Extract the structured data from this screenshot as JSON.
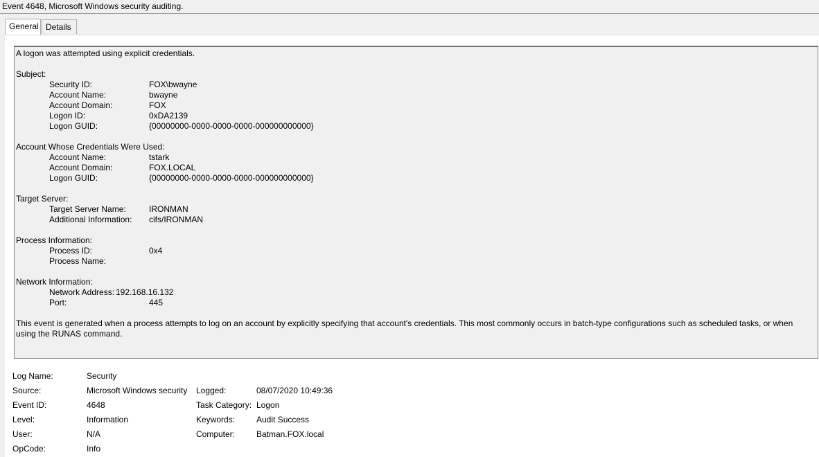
{
  "window": {
    "title": "Event 4648, Microsoft Windows security auditing."
  },
  "tabs": [
    {
      "label": "General"
    },
    {
      "label": "Details"
    }
  ],
  "description": {
    "intro": "A logon was attempted using explicit credentials.",
    "subject": {
      "heading": "Subject:",
      "fields": [
        {
          "label": "Security ID:",
          "value": "FOX\\bwayne"
        },
        {
          "label": "Account Name:",
          "value": "bwayne"
        },
        {
          "label": "Account Domain:",
          "value": "FOX"
        },
        {
          "label": "Logon ID:",
          "value": "0xDA2139"
        },
        {
          "label": "Logon GUID:",
          "value": "{00000000-0000-0000-0000-000000000000}"
        }
      ]
    },
    "credentials": {
      "heading": "Account Whose Credentials Were Used:",
      "fields": [
        {
          "label": "Account Name:",
          "value": "tstark"
        },
        {
          "label": "Account Domain:",
          "value": "FOX.LOCAL"
        },
        {
          "label": "Logon GUID:",
          "value": "{00000000-0000-0000-0000-000000000000}"
        }
      ]
    },
    "target": {
      "heading": "Target Server:",
      "fields": [
        {
          "label": "Target Server Name:",
          "value": "IRONMAN"
        },
        {
          "label": "Additional Information:",
          "value": "cifs/IRONMAN"
        }
      ]
    },
    "process": {
      "heading": "Process Information:",
      "fields": [
        {
          "label": "Process ID:",
          "value": "0x4"
        },
        {
          "label": "Process Name:",
          "value": ""
        }
      ]
    },
    "network": {
      "heading": "Network Information:",
      "fields": [
        {
          "label": "Network Address:",
          "value": "192.168.16.132"
        },
        {
          "label": "Port:",
          "value": "445"
        }
      ]
    },
    "footer": "This event is generated when a process attempts to log on an account by explicitly specifying that account's credentials.  This most commonly occurs in batch-type configurations such as scheduled tasks, or when using the RUNAS command."
  },
  "event_meta": {
    "log_name": {
      "label": "Log Name:",
      "value": "Security"
    },
    "source": {
      "label": "Source:",
      "value": "Microsoft Windows security"
    },
    "logged": {
      "label": "Logged:",
      "value": "08/07/2020 10:49:36"
    },
    "event_id": {
      "label": "Event ID:",
      "value": "4648"
    },
    "task_category": {
      "label": "Task Category:",
      "value": "Logon"
    },
    "level": {
      "label": "Level:",
      "value": "Information"
    },
    "keywords": {
      "label": "Keywords:",
      "value": "Audit Success"
    },
    "user": {
      "label": "User:",
      "value": "N/A"
    },
    "computer": {
      "label": "Computer:",
      "value": "Batman.FOX.local"
    },
    "opcode": {
      "label": "OpCode:",
      "value": "Info"
    }
  }
}
